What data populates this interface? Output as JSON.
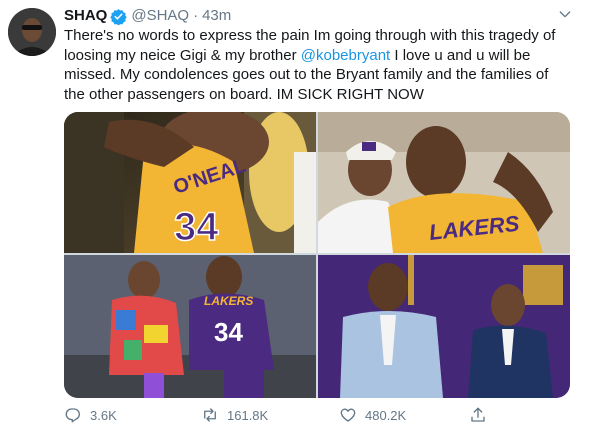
{
  "author": {
    "name": "SHAQ",
    "handle": "@SHAQ",
    "separator": "·",
    "time": "43m",
    "verified": true
  },
  "tweet": {
    "text_before": "There's no words to express the pain Im going through with this tragedy of loosing my neice Gigi & my brother ",
    "mention": "@kobebryant",
    "text_after": " I love u and u will be missed. My condolences goes out to the Bryant family and the families of the other passengers on board. IM SICK RIGHT NOW"
  },
  "media": {
    "count": 4,
    "jersey_back_text": "O'NEAL",
    "jersey_number": "34",
    "lakers_text": "LAKERS"
  },
  "actions": {
    "replies": "3.6K",
    "retweets": "161.8K",
    "likes": "480.2K"
  },
  "colors": {
    "accent": "#1b95e0",
    "verified": "#1da1f2",
    "muted": "#657786",
    "lakers_gold": "#f2b634",
    "lakers_purple": "#4b2a82"
  },
  "icons": [
    "verified-badge-icon",
    "caret-down-icon",
    "reply-icon",
    "retweet-icon",
    "like-icon",
    "share-icon"
  ]
}
